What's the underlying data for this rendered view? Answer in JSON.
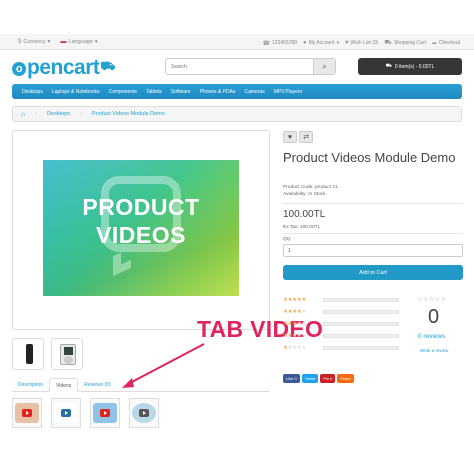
{
  "header": {
    "currency": "Currency",
    "language": "Language",
    "phone": "123456789",
    "my_account": "My Account",
    "wish_list": "Wish List (0)",
    "shopping_cart": "Shopping Cart",
    "checkout": "Checkout",
    "logo": "opencart",
    "search_placeholder": "Search",
    "cart_button": "0 item(s) - 0.00TL"
  },
  "menu": {
    "items": [
      "Desktops",
      "Laptops & Notebooks",
      "Components",
      "Tablets",
      "Software",
      "Phones & PDAs",
      "Cameras",
      "MP3 Players"
    ]
  },
  "breadcrumb": {
    "items": [
      "Desktops",
      "Product Videos Module Demo"
    ]
  },
  "product": {
    "poster_line1": "PRODUCT",
    "poster_line2": "VIDEOS",
    "title": "Product Videos Module Demo",
    "code": "Product Code: product 21",
    "availability": "Availability: In Stock",
    "price": "100.00TL",
    "ex_tax": "Ex Tax: 100.00TL",
    "qty_label": "Qty",
    "qty_value": "1",
    "add_to_cart": "Add to Cart"
  },
  "tabs": [
    "Description",
    "Videos",
    "Reviews (0)"
  ],
  "annotation": "TAB VIDEO",
  "rating": {
    "count": "0",
    "reviews_label": "0 reviews",
    "write_review": "Write a review",
    "star_rows": [
      5,
      4,
      3,
      2,
      1
    ]
  },
  "social": [
    "Like 0",
    "Tweet",
    "Pin it",
    "Share"
  ],
  "colors": {
    "brand_blue": "#229ac8",
    "annotation_pink": "#e0245e",
    "star": "#f0ad4e",
    "play_red": "#e62117"
  },
  "icons": [
    "gear-icon",
    "phone-icon",
    "user-icon",
    "heart-icon",
    "cart-icon",
    "share-icon",
    "search-icon",
    "home-icon",
    "compare-icon",
    "play-icon"
  ]
}
